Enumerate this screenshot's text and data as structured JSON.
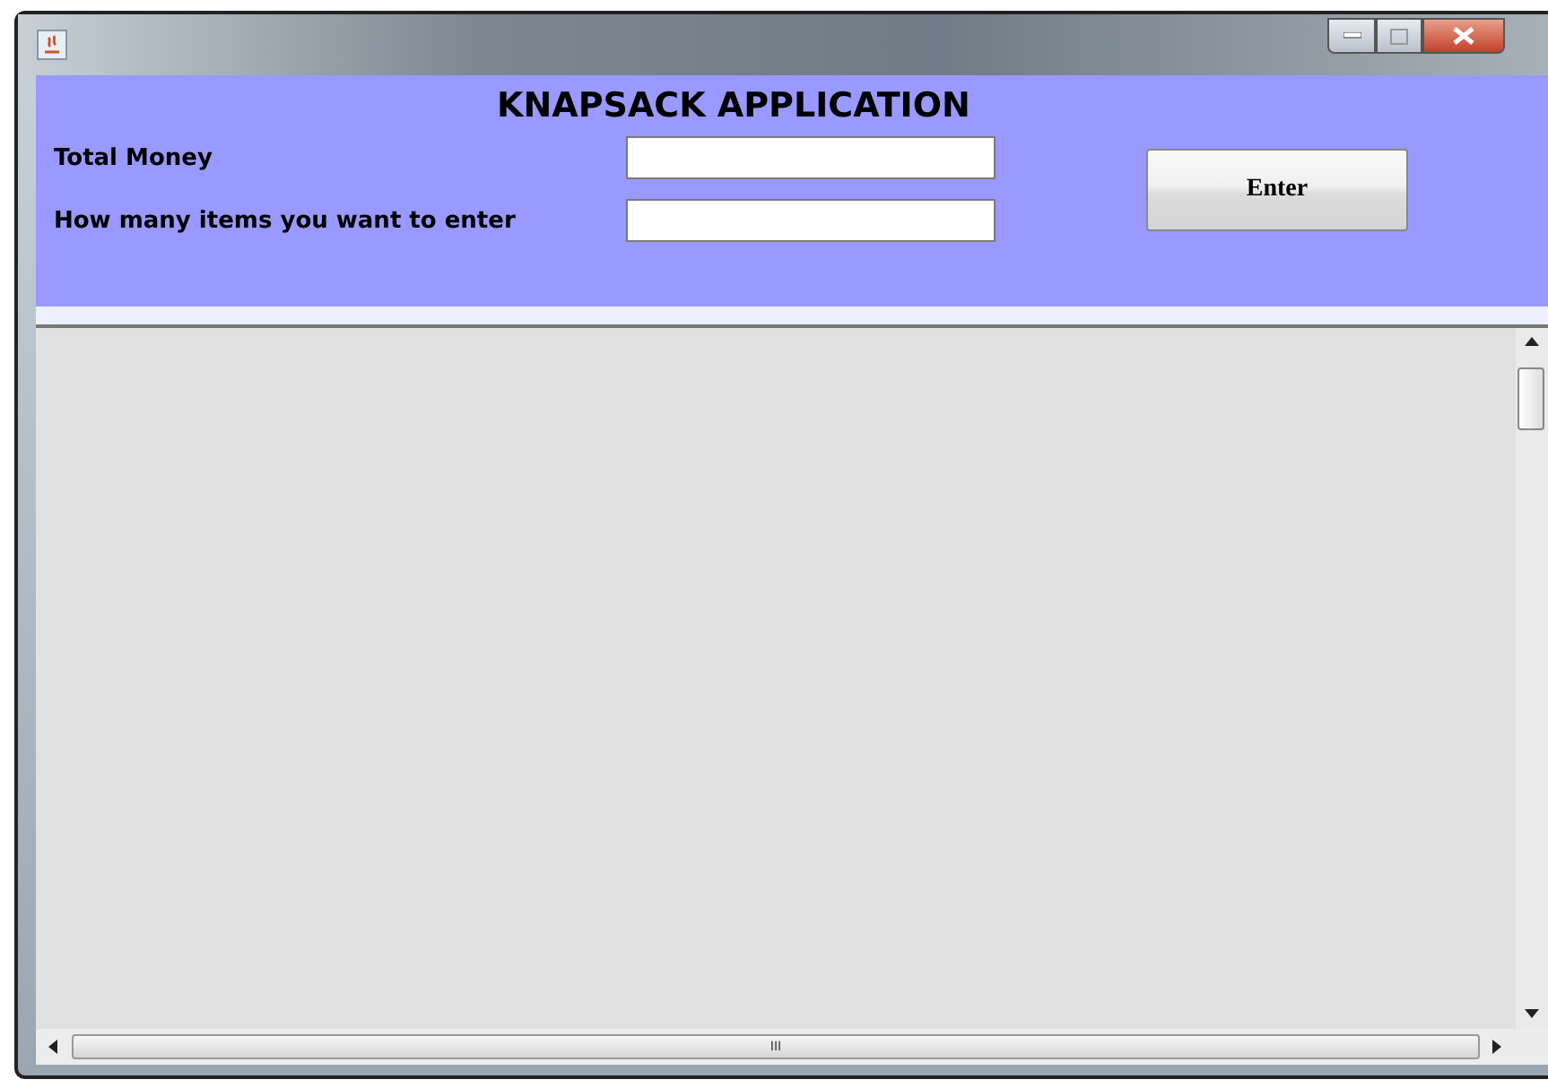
{
  "header": {
    "title": "KNAPSACK APPLICATION"
  },
  "fields": [
    {
      "label": "Total Money"
    },
    {
      "label": "How many items you want to enter"
    }
  ],
  "button": {
    "label": "Enter"
  },
  "scroll_bars": {
    "horizontal_grip": "III"
  }
}
